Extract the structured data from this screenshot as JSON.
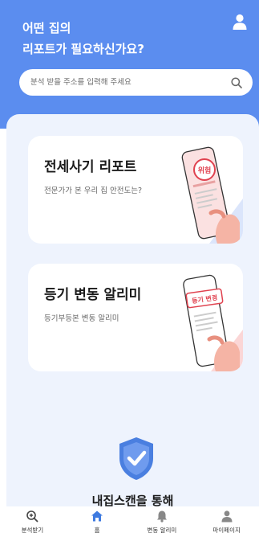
{
  "header": {
    "title_line1": "어떤 집의",
    "title_line2": "리포트가 필요하신가요?",
    "icon": "person-icon"
  },
  "search": {
    "placeholder": "분석 받을 주소를 입력해 주세요",
    "icon": "search-icon"
  },
  "cards": [
    {
      "title": "전세사기 리포트",
      "subtitle": "전문가가 본 우리 집 안전도는?",
      "badge": "위험"
    },
    {
      "title": "등기 변동 알리미",
      "subtitle": "등기부등본 변동 알리미",
      "badge": "등기 변경"
    }
  ],
  "feature": {
    "heading": "내집스캔을 통해",
    "icon": "shield-check-icon"
  },
  "tabs": [
    {
      "label": "분석받기",
      "icon": "search-plus-icon",
      "active": false
    },
    {
      "label": "홈",
      "icon": "home-icon",
      "active": true
    },
    {
      "label": "변동 알리미",
      "icon": "bell-icon",
      "active": false
    },
    {
      "label": "마이페이지",
      "icon": "person-icon",
      "active": false
    }
  ],
  "colors": {
    "primary": "#5b8def",
    "background": "#eef3fd",
    "danger": "#e0424f",
    "illustration_bg": "#fbe1e1"
  }
}
